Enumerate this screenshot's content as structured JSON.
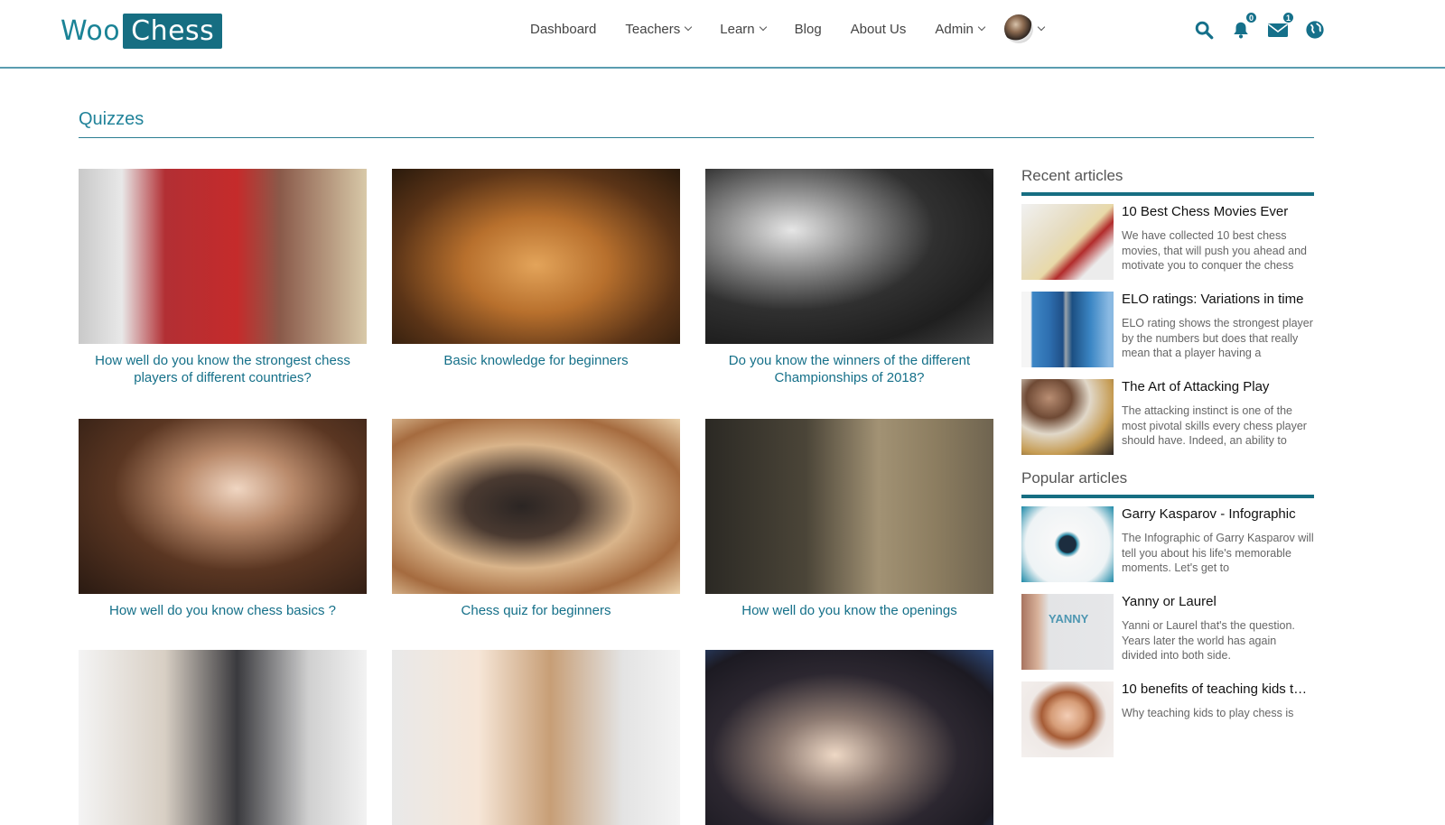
{
  "brand": {
    "part1": "Woo",
    "part2": "Chess",
    "accent": "#166e82"
  },
  "nav": [
    {
      "label": "Dashboard",
      "dropdown": false
    },
    {
      "label": "Teachers",
      "dropdown": true
    },
    {
      "label": "Learn",
      "dropdown": true
    },
    {
      "label": "Blog",
      "dropdown": false
    },
    {
      "label": "About Us",
      "dropdown": false
    },
    {
      "label": "Admin",
      "dropdown": true
    }
  ],
  "header_icons": {
    "search": "search-icon",
    "notifications": {
      "icon": "bell-icon",
      "count": "0"
    },
    "messages": {
      "icon": "envelope-icon",
      "count": "1"
    },
    "language": "globe-icon"
  },
  "page": {
    "title": "Quizzes"
  },
  "quizzes": [
    {
      "title": "How well do you know the strongest chess players of different countries?",
      "image": "flags-chess-pieces"
    },
    {
      "title": "Basic knowledge for beginners",
      "image": "wooden-pawns"
    },
    {
      "title": "Do you know the winners of the different Championships of 2018?",
      "image": "champion-trophy"
    },
    {
      "title": "How well do you know chess basics ?",
      "image": "hand-moving-piece"
    },
    {
      "title": "Chess quiz for beginners",
      "image": "fallen-king"
    },
    {
      "title": "How well do you know the openings",
      "image": "pawn-vs-army"
    },
    {
      "title": "",
      "image": "businessman-chess"
    },
    {
      "title": "",
      "image": "child-hand-chess"
    },
    {
      "title": "",
      "image": "player-hand"
    }
  ],
  "sidebar": {
    "recent_heading": "Recent articles",
    "recent": [
      {
        "title": "10 Best Chess Movies Ever",
        "excerpt": "We have collected 10 best chess movies, that will push you ahead and motivate you to conquer the chess"
      },
      {
        "title": "ELO ratings: Variations in time",
        "excerpt": "ELO rating shows the strongest player by the numbers but does that really mean that a player having a"
      },
      {
        "title": "The Art of Attacking Play",
        "excerpt": "The attacking instinct is one of the most pivotal skills every chess player should have. Indeed, an ability to"
      }
    ],
    "popular_heading": "Popular articles",
    "popular": [
      {
        "title": "Garry Kasparov - Infographic",
        "excerpt": "The Infographic of Garry Kasparov will tell you about his life's memorable moments. Let's get to"
      },
      {
        "title": "Yanny or Laurel",
        "excerpt": "Yanni or Laurel that's the question. Years later the world has again divided into both side."
      },
      {
        "title": "10 benefits of teaching kids to…",
        "excerpt": "Why teaching kids to play chess is"
      }
    ]
  }
}
